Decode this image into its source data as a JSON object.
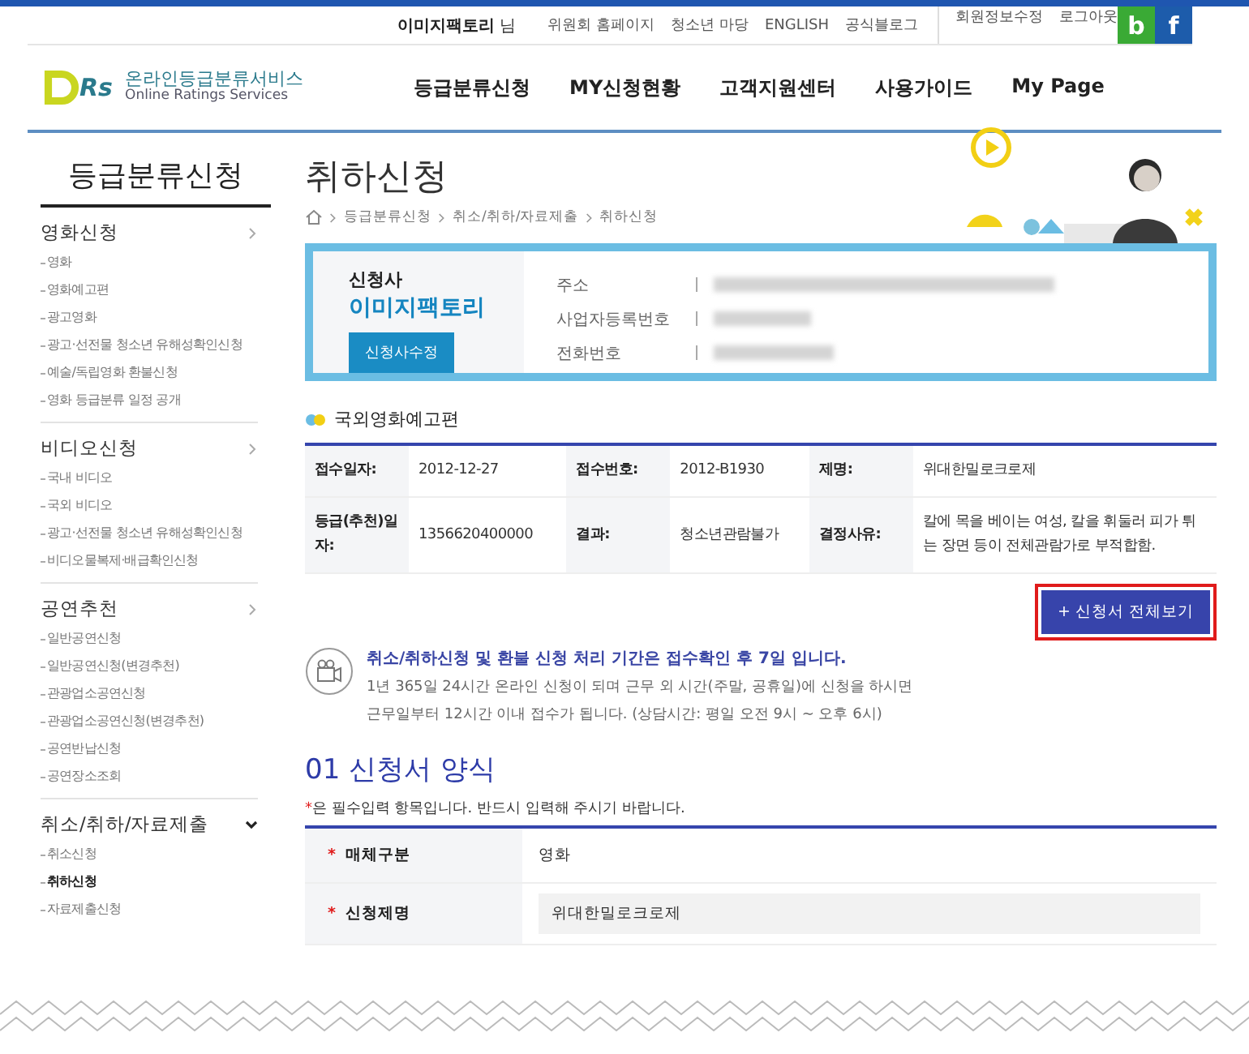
{
  "top_bar": {
    "user_name": "이미지팩토리",
    "user_suffix": "님",
    "links": [
      "위원회 홈페이지",
      "청소년 마당",
      "ENGLISH",
      "공식블로그"
    ],
    "account_links": [
      "회원정보수정",
      "로그아웃"
    ],
    "social": [
      {
        "label": "b",
        "color": "#3aaa35"
      },
      {
        "label": "f",
        "color": "#1d5cab"
      }
    ]
  },
  "logo": {
    "mark": "Rs",
    "title": "온라인등급분류서비스",
    "subtitle": "Online Ratings Services"
  },
  "nav": [
    "등급분류신청",
    "MY신청현황",
    "고객지원센터",
    "사용가이드",
    "My Page"
  ],
  "sidebar": {
    "title": "등급분류신청",
    "groups": [
      {
        "label": "영화신청",
        "expanded": false,
        "items": [
          {
            "label": "영화",
            "selected": false
          },
          {
            "label": "영화예고편",
            "selected": false
          },
          {
            "label": "광고영화",
            "selected": false
          },
          {
            "label": "광고·선전물 청소년 유해성확인신청",
            "selected": false
          },
          {
            "label": "예술/독립영화 환불신청",
            "selected": false
          },
          {
            "label": "영화 등급분류 일정 공개",
            "selected": false
          }
        ]
      },
      {
        "label": "비디오신청",
        "expanded": false,
        "items": [
          {
            "label": "국내 비디오",
            "selected": false
          },
          {
            "label": "국외 비디오",
            "selected": false
          },
          {
            "label": "광고·선전물 청소년 유해성확인신청",
            "selected": false
          },
          {
            "label": "비디오물복제·배급확인신청",
            "selected": false
          }
        ]
      },
      {
        "label": "공연추천",
        "expanded": false,
        "items": [
          {
            "label": "일반공연신청",
            "selected": false
          },
          {
            "label": "일반공연신청(변경추천)",
            "selected": false
          },
          {
            "label": "관광업소공연신청",
            "selected": false
          },
          {
            "label": "관광업소공연신청(변경추천)",
            "selected": false
          },
          {
            "label": "공연반납신청",
            "selected": false
          },
          {
            "label": "공연장소조회",
            "selected": false
          }
        ]
      },
      {
        "label": "취소/취하/자료제출",
        "expanded": true,
        "items": [
          {
            "label": "취소신청",
            "selected": false
          },
          {
            "label": "취하신청",
            "selected": true
          },
          {
            "label": "자료제출신청",
            "selected": false
          }
        ]
      }
    ]
  },
  "page_title": "취하신청",
  "breadcrumb": [
    "등급분류신청",
    "취소/취하/자료제출",
    "취하신청"
  ],
  "applicant": {
    "label": "신청사",
    "name": "이미지팩토리",
    "edit_button": "신청사수정",
    "fields": [
      "주소",
      "사업자등록번호",
      "전화번호"
    ]
  },
  "section_heading": "국외영화예고편",
  "info_table": [
    [
      {
        "label": "접수일자:",
        "value": "2012-12-27"
      },
      {
        "label": "접수번호:",
        "value": "2012-B1930"
      },
      {
        "label": "제명:",
        "value": "위대한밀로크로제"
      }
    ],
    [
      {
        "label": "등급(추천)일자:",
        "value": "1356620400000"
      },
      {
        "label": "결과:",
        "value": "청소년관람불가"
      },
      {
        "label": "결정사유:",
        "value": "칼에 목을 베이는 여성, 칼을 휘둘러 피가 튀는 장면 등이 전체관람가로 부적합함."
      }
    ]
  ],
  "full_view_button": {
    "label": "+ 신청서 전체보기",
    "highlighted": true
  },
  "notice": {
    "title": "취소/취하신청 및 환불 신청 처리 기간은 접수확인 후 7일 입니다.",
    "lines": [
      "1년 365일 24시간 온라인 신청이 되며 근무 외 시간(주말, 공휴일)에 신청을 하시면",
      "근무일부터 12시간 이내 접수가 됩니다. (상담시간: 평일 오전 9시 ~ 오후 6시)"
    ]
  },
  "form": {
    "title": "01 신청서 양식",
    "required_mark": "*",
    "note": "은 필수입력 항목입니다. 반드시 입력해 주시기 바랍니다.",
    "rows": [
      {
        "label": "매체구분",
        "required": true,
        "kind": "text",
        "value": "영화"
      },
      {
        "label": "신청제명",
        "required": true,
        "kind": "input",
        "value": "위대한밀로크로제"
      }
    ]
  }
}
